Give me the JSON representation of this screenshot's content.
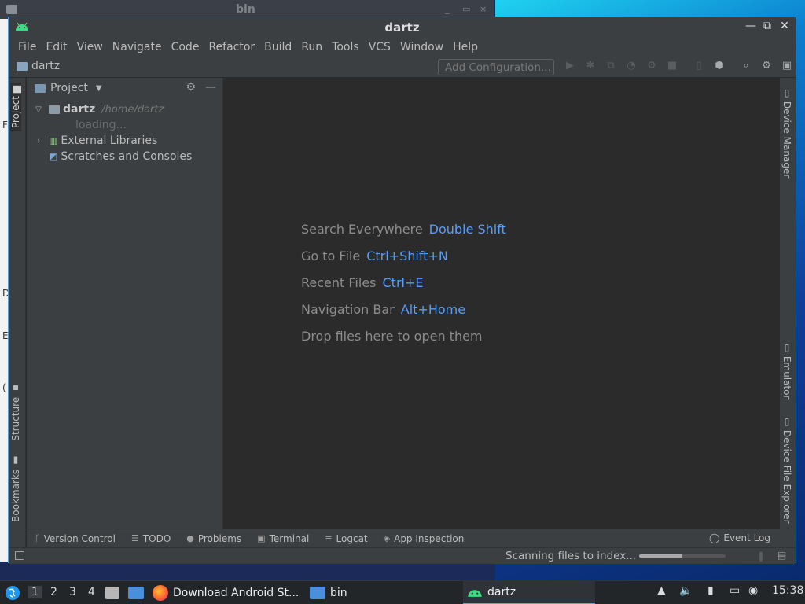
{
  "background_window": {
    "title": "bin",
    "controls": [
      "_",
      "▭",
      "×"
    ],
    "side_letters": [
      "F",
      "D",
      "E",
      "("
    ]
  },
  "window": {
    "title": "dartz",
    "controls": [
      "—",
      "⧉",
      "✕"
    ]
  },
  "menu": [
    "File",
    "Edit",
    "View",
    "Navigate",
    "Code",
    "Refactor",
    "Build",
    "Run",
    "Tools",
    "VCS",
    "Window",
    "Help"
  ],
  "breadcrumb": "dartz",
  "toolbar": {
    "add_configuration": "Add Configuration..."
  },
  "left_tool_tabs": {
    "project": "Project",
    "structure": "Structure",
    "bookmarks": "Bookmarks"
  },
  "right_tool_tabs": {
    "device_manager": "Device Manager",
    "emulator": "Emulator",
    "device_file_explorer": "Device File Explorer"
  },
  "project_panel": {
    "title": "Project",
    "tree": {
      "root_name": "dartz",
      "root_path": "/home/dartz",
      "loading": "loading...",
      "external_libraries": "External Libraries",
      "scratches": "Scratches and Consoles"
    }
  },
  "editor_hints": [
    {
      "label": "Search Everywhere",
      "key": "Double Shift"
    },
    {
      "label": "Go to File",
      "key": "Ctrl+Shift+N"
    },
    {
      "label": "Recent Files",
      "key": "Ctrl+E"
    },
    {
      "label": "Navigation Bar",
      "key": "Alt+Home"
    },
    {
      "label": "Drop files here to open them",
      "key": ""
    }
  ],
  "bottom_tabs": {
    "version_control": "Version Control",
    "todo": "TODO",
    "problems": "Problems",
    "terminal": "Terminal",
    "logcat": "Logcat",
    "app_inspection": "App Inspection",
    "event_log": "Event Log"
  },
  "status": {
    "text": "Scanning files to index...",
    "progress": 0.5
  },
  "taskbar": {
    "workspaces": [
      "1",
      "2",
      "3",
      "4"
    ],
    "tasks": {
      "browser": "Download Android St...",
      "files": "bin",
      "ide": "dartz"
    },
    "clock": "15:38"
  },
  "colors": {
    "accent": "#589df6",
    "ide_bg": "#2b2b2b",
    "panel_bg": "#3c3f41",
    "android_green": "#3ddc84"
  }
}
